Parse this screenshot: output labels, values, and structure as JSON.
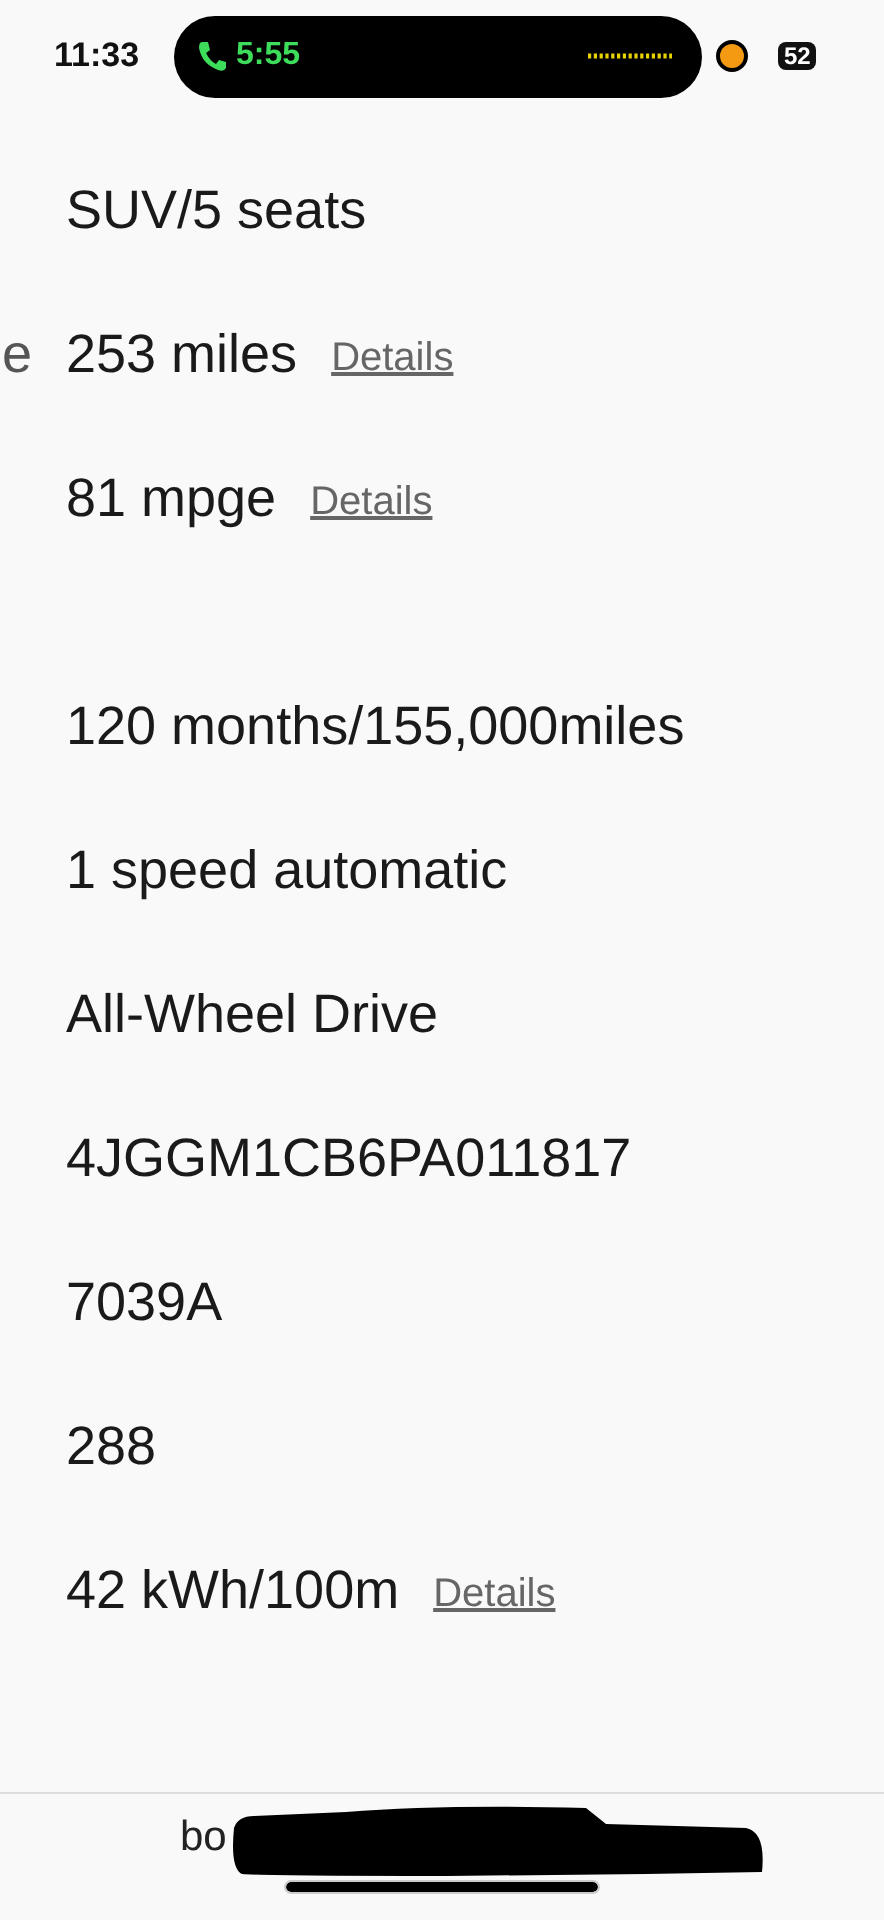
{
  "status_bar": {
    "time": "11:33",
    "call_timer": "5:55",
    "battery": "52"
  },
  "sections": [
    {
      "rows": [
        {
          "value": "SUV/5 seats"
        },
        {
          "side_label": "e",
          "value": "253 miles",
          "link": "Details"
        },
        {
          "value": "81 mpge",
          "link": "Details"
        }
      ]
    },
    {
      "rows": [
        {
          "value": "120 months/155,000miles"
        },
        {
          "value": "1 speed automatic"
        },
        {
          "value": "All-Wheel Drive"
        },
        {
          "value": "4JGGM1CB6PA011817"
        },
        {
          "value": "7039A"
        },
        {
          "value": "288"
        },
        {
          "value": "42 kWh/100m",
          "link": "Details"
        }
      ]
    }
  ],
  "address_bar": {
    "url_visible": "bo"
  }
}
